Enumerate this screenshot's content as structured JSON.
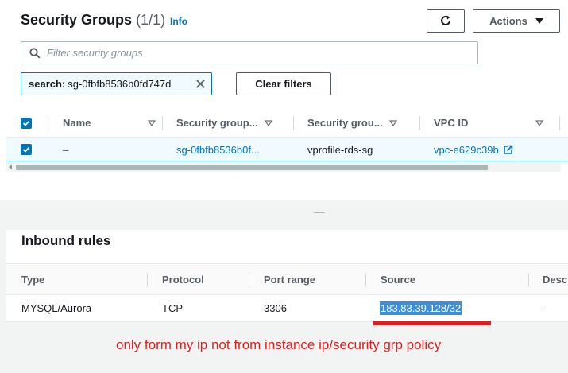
{
  "header": {
    "title": "Security Groups",
    "count": "(1/1)",
    "info": "Info",
    "actions_label": "Actions"
  },
  "search": {
    "placeholder": "Filter security groups",
    "value": ""
  },
  "filter_token": {
    "key": "search:",
    "value": "sg-0fbfb8536b0fd747d"
  },
  "clear_filters_label": "Clear filters",
  "sg_table": {
    "columns": [
      "Name",
      "Security group...",
      "Security grou...",
      "VPC ID"
    ],
    "rows": [
      {
        "name": "–",
        "sg_id": "sg-0fbfb8536b0f...",
        "sg_name": "vprofile-rds-sg",
        "vpc_id": "vpc-e629c39b",
        "selected": true
      }
    ]
  },
  "inbound": {
    "title": "Inbound rules",
    "columns": [
      "Type",
      "Protocol",
      "Port range",
      "Source",
      "Desc"
    ],
    "rows": [
      {
        "type": "MYSQL/Aurora",
        "protocol": "TCP",
        "port_range": "3306",
        "source": "183.83.39.128/32",
        "description": "-"
      }
    ]
  },
  "annotation": "only form my ip not from instance ip/security grp policy",
  "colors": {
    "link": "#0073bb",
    "annotation": "#e02020",
    "highlight": "#3b8ed8"
  },
  "icons": [
    "search-icon",
    "refresh-icon",
    "caret-down-icon",
    "close-icon",
    "sort-icon",
    "checkbox-checked-icon",
    "external-link-icon",
    "resize-grip-icon"
  ]
}
